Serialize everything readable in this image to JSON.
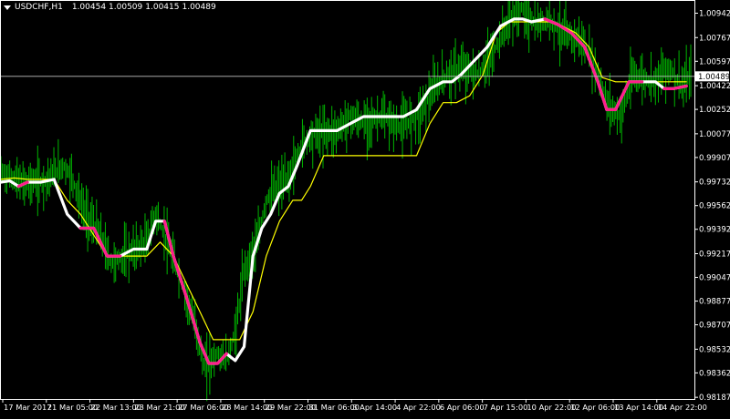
{
  "header": {
    "symbol": "USDCHF,H1",
    "open": "1.00454",
    "high": "1.00509",
    "low": "1.00415",
    "close": "1.00489"
  },
  "colors": {
    "background": "#000000",
    "frame": "#ffffff",
    "candles": "#00b400",
    "ma_fast": "#ffffff",
    "ma_fast_down": "#ff1e8c",
    "ma_slow": "#ffff00",
    "current_price_line": "#c0c0c0"
  },
  "chart_data": {
    "type": "line",
    "title": "USDCHF,H1",
    "y_axis": {
      "position": "right",
      "range": [
        0.98175,
        1.0103
      ],
      "tick_labels": [
        "1.00942",
        "1.00767",
        "1.00597",
        "1.00422",
        "1.00252",
        "1.00077",
        "0.99907",
        "0.99732",
        "0.99562",
        "0.99392",
        "0.99217",
        "0.99047",
        "0.98877",
        "0.98707",
        "0.98532",
        "0.98362",
        "0.98187"
      ]
    },
    "x_axis": {
      "tick_labels": [
        "17 Mar 2017",
        "21 Mar 05:00",
        "22 Mar 13:00",
        "23 Mar 21:00",
        "27 Mar 06:00",
        "28 Mar 14:00",
        "29 Mar 22:00",
        "31 Mar 06:00",
        "3 Apr 14:00",
        "4 Apr 22:00",
        "6 Apr 06:00",
        "7 Apr 15:00",
        "10 Apr 22:00",
        "12 Apr 06:00",
        "13 Apr 14:00",
        "14 Apr 22:00"
      ]
    },
    "current_price": 1.00489,
    "current_price_label": "1.00489",
    "grid": false,
    "x_range": [
      0,
      156
    ],
    "series": [
      {
        "kind": "candles",
        "close_path": [
          [
            0,
            0.998
          ],
          [
            5,
            0.9972
          ],
          [
            10,
            0.9974
          ],
          [
            14,
            0.9985
          ],
          [
            16,
            0.9977
          ],
          [
            19,
            0.995
          ],
          [
            22,
            0.9938
          ],
          [
            25,
            0.9915
          ],
          [
            29,
            0.9922
          ],
          [
            33,
            0.993
          ],
          [
            35,
            0.995
          ],
          [
            37,
            0.9935
          ],
          [
            41,
            0.99
          ],
          [
            44,
            0.987
          ],
          [
            46,
            0.984
          ],
          [
            49,
            0.985
          ],
          [
            51,
            0.9845
          ],
          [
            53,
            0.9865
          ],
          [
            55,
            0.991
          ],
          [
            58,
            0.993
          ],
          [
            60,
            0.996
          ],
          [
            62,
            0.9968
          ],
          [
            65,
            0.9975
          ],
          [
            68,
            1.0
          ],
          [
            71,
            1.0008
          ],
          [
            76,
            1.001
          ],
          [
            79,
            1.002
          ],
          [
            82,
            1.0015
          ],
          [
            86,
            1.002
          ],
          [
            90,
            1.0013
          ],
          [
            94,
            1.002
          ],
          [
            98,
            1.004
          ],
          [
            101,
            1.005
          ],
          [
            104,
            1.0055
          ],
          [
            108,
            1.005
          ],
          [
            112,
            1.007
          ],
          [
            115,
            1.009
          ],
          [
            118,
            1.0098
          ],
          [
            121,
            1.0085
          ],
          [
            124,
            1.009
          ],
          [
            127,
            1.008
          ],
          [
            131,
            1.0075
          ],
          [
            134,
            1.006
          ],
          [
            137,
            1.003
          ],
          [
            140,
            1.002
          ],
          [
            143,
            1.005
          ],
          [
            147,
            1.0045
          ],
          [
            151,
            1.0055
          ],
          [
            154,
            1.0042
          ],
          [
            156,
            1.00489
          ]
        ]
      },
      {
        "name": "",
        "kind": "fast-ma",
        "x": [
          0,
          2,
          4,
          6,
          9,
          12,
          15,
          18,
          21,
          24,
          27,
          30,
          33,
          35,
          37,
          39,
          42,
          45,
          47,
          49,
          51,
          53,
          55,
          57,
          59,
          61,
          63,
          65,
          67,
          70,
          73,
          76,
          79,
          82,
          85,
          88,
          91,
          94,
          97,
          100,
          102,
          104,
          107,
          110,
          113,
          116,
          118,
          120,
          123,
          126,
          129,
          132,
          135,
          137,
          139,
          142,
          145,
          148,
          150,
          152,
          155
        ],
        "y": [
          0.9973,
          0.9974,
          0.997,
          0.9973,
          0.9973,
          0.9975,
          0.995,
          0.994,
          0.994,
          0.992,
          0.992,
          0.9925,
          0.9925,
          0.9945,
          0.9945,
          0.992,
          0.989,
          0.9858,
          0.9843,
          0.9843,
          0.985,
          0.9845,
          0.9855,
          0.992,
          0.994,
          0.995,
          0.9965,
          0.997,
          0.9985,
          1.001,
          1.001,
          1.001,
          1.0015,
          1.002,
          1.002,
          1.002,
          1.002,
          1.0025,
          1.004,
          1.0045,
          1.0045,
          1.005,
          1.006,
          1.007,
          1.0085,
          1.009,
          1.009,
          1.0088,
          1.009,
          1.0086,
          1.008,
          1.007,
          1.0045,
          1.0025,
          1.0025,
          1.0045,
          1.0045,
          1.0045,
          1.004,
          1.004,
          1.0042
        ],
        "down_color_ranges": [
          [
            4,
            8
          ],
          [
            16,
            27
          ],
          [
            37,
            51
          ],
          [
            121,
            147
          ],
          [
            150,
            156
          ]
        ]
      },
      {
        "name": "",
        "kind": "slow-ma",
        "x": [
          0,
          3,
          6,
          9,
          12,
          15,
          18,
          21,
          24,
          27,
          30,
          33,
          36,
          39,
          42,
          45,
          48,
          51,
          54,
          57,
          60,
          63,
          66,
          68,
          70,
          73,
          76,
          79,
          82,
          85,
          88,
          91,
          94,
          97,
          100,
          103,
          106,
          109,
          112,
          115,
          118,
          121,
          124,
          127,
          130,
          133,
          136,
          139,
          142,
          145,
          148,
          151,
          155
        ],
        "y": [
          0.9975,
          0.9976,
          0.9975,
          0.9975,
          0.9975,
          0.996,
          0.995,
          0.9935,
          0.992,
          0.992,
          0.992,
          0.992,
          0.993,
          0.992,
          0.99,
          0.988,
          0.986,
          0.986,
          0.986,
          0.988,
          0.992,
          0.9945,
          0.996,
          0.996,
          0.997,
          0.9992,
          0.9992,
          0.9992,
          0.9992,
          0.9992,
          0.9992,
          0.9992,
          0.9992,
          1.0015,
          1.003,
          1.003,
          1.0035,
          1.005,
          1.008,
          1.0088,
          1.0088,
          1.0088,
          1.0088,
          1.0085,
          1.008,
          1.007,
          1.0048,
          1.0045,
          1.0045,
          1.0045,
          1.0045,
          1.0045,
          1.0045
        ]
      }
    ]
  }
}
